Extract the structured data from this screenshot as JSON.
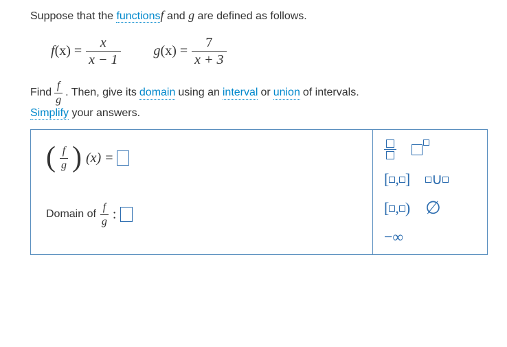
{
  "intro": {
    "prefix": "Suppose that the ",
    "link": "functions",
    "f_italic": "f",
    "mid1": " and ",
    "g_italic": "g",
    "suffix": " are defined as follows."
  },
  "equations": {
    "f_lhs_name": "f",
    "f_lhs_arg": "(x) =",
    "f_num": "x",
    "f_den": "x − 1",
    "g_lhs_name": "g",
    "g_lhs_arg": "(x) =",
    "g_num": "7",
    "g_den": "x + 3"
  },
  "find": {
    "prefix": "Find ",
    "frac_num": "f",
    "frac_den": "g",
    "mid1": ". Then, give its ",
    "link_domain": "domain",
    "mid2": " using an ",
    "link_interval": "interval",
    "mid3": " or ",
    "link_union": "union",
    "suffix": " of intervals."
  },
  "simplify": {
    "link": "Simplify",
    "suffix": " your answers."
  },
  "answer": {
    "line1_frac_num": "f",
    "line1_frac_den": "g",
    "line1_arg": "(x)",
    "line1_eq": " = ",
    "line2_prefix": "Domain of ",
    "line2_frac_num": "f",
    "line2_frac_den": "g",
    "line2_colon": " : "
  },
  "palette": {
    "closed": "[□,□]",
    "union_sym": "∪",
    "halfopen": "[□,□)",
    "empty": "∅",
    "neg_inf": "−∞"
  }
}
